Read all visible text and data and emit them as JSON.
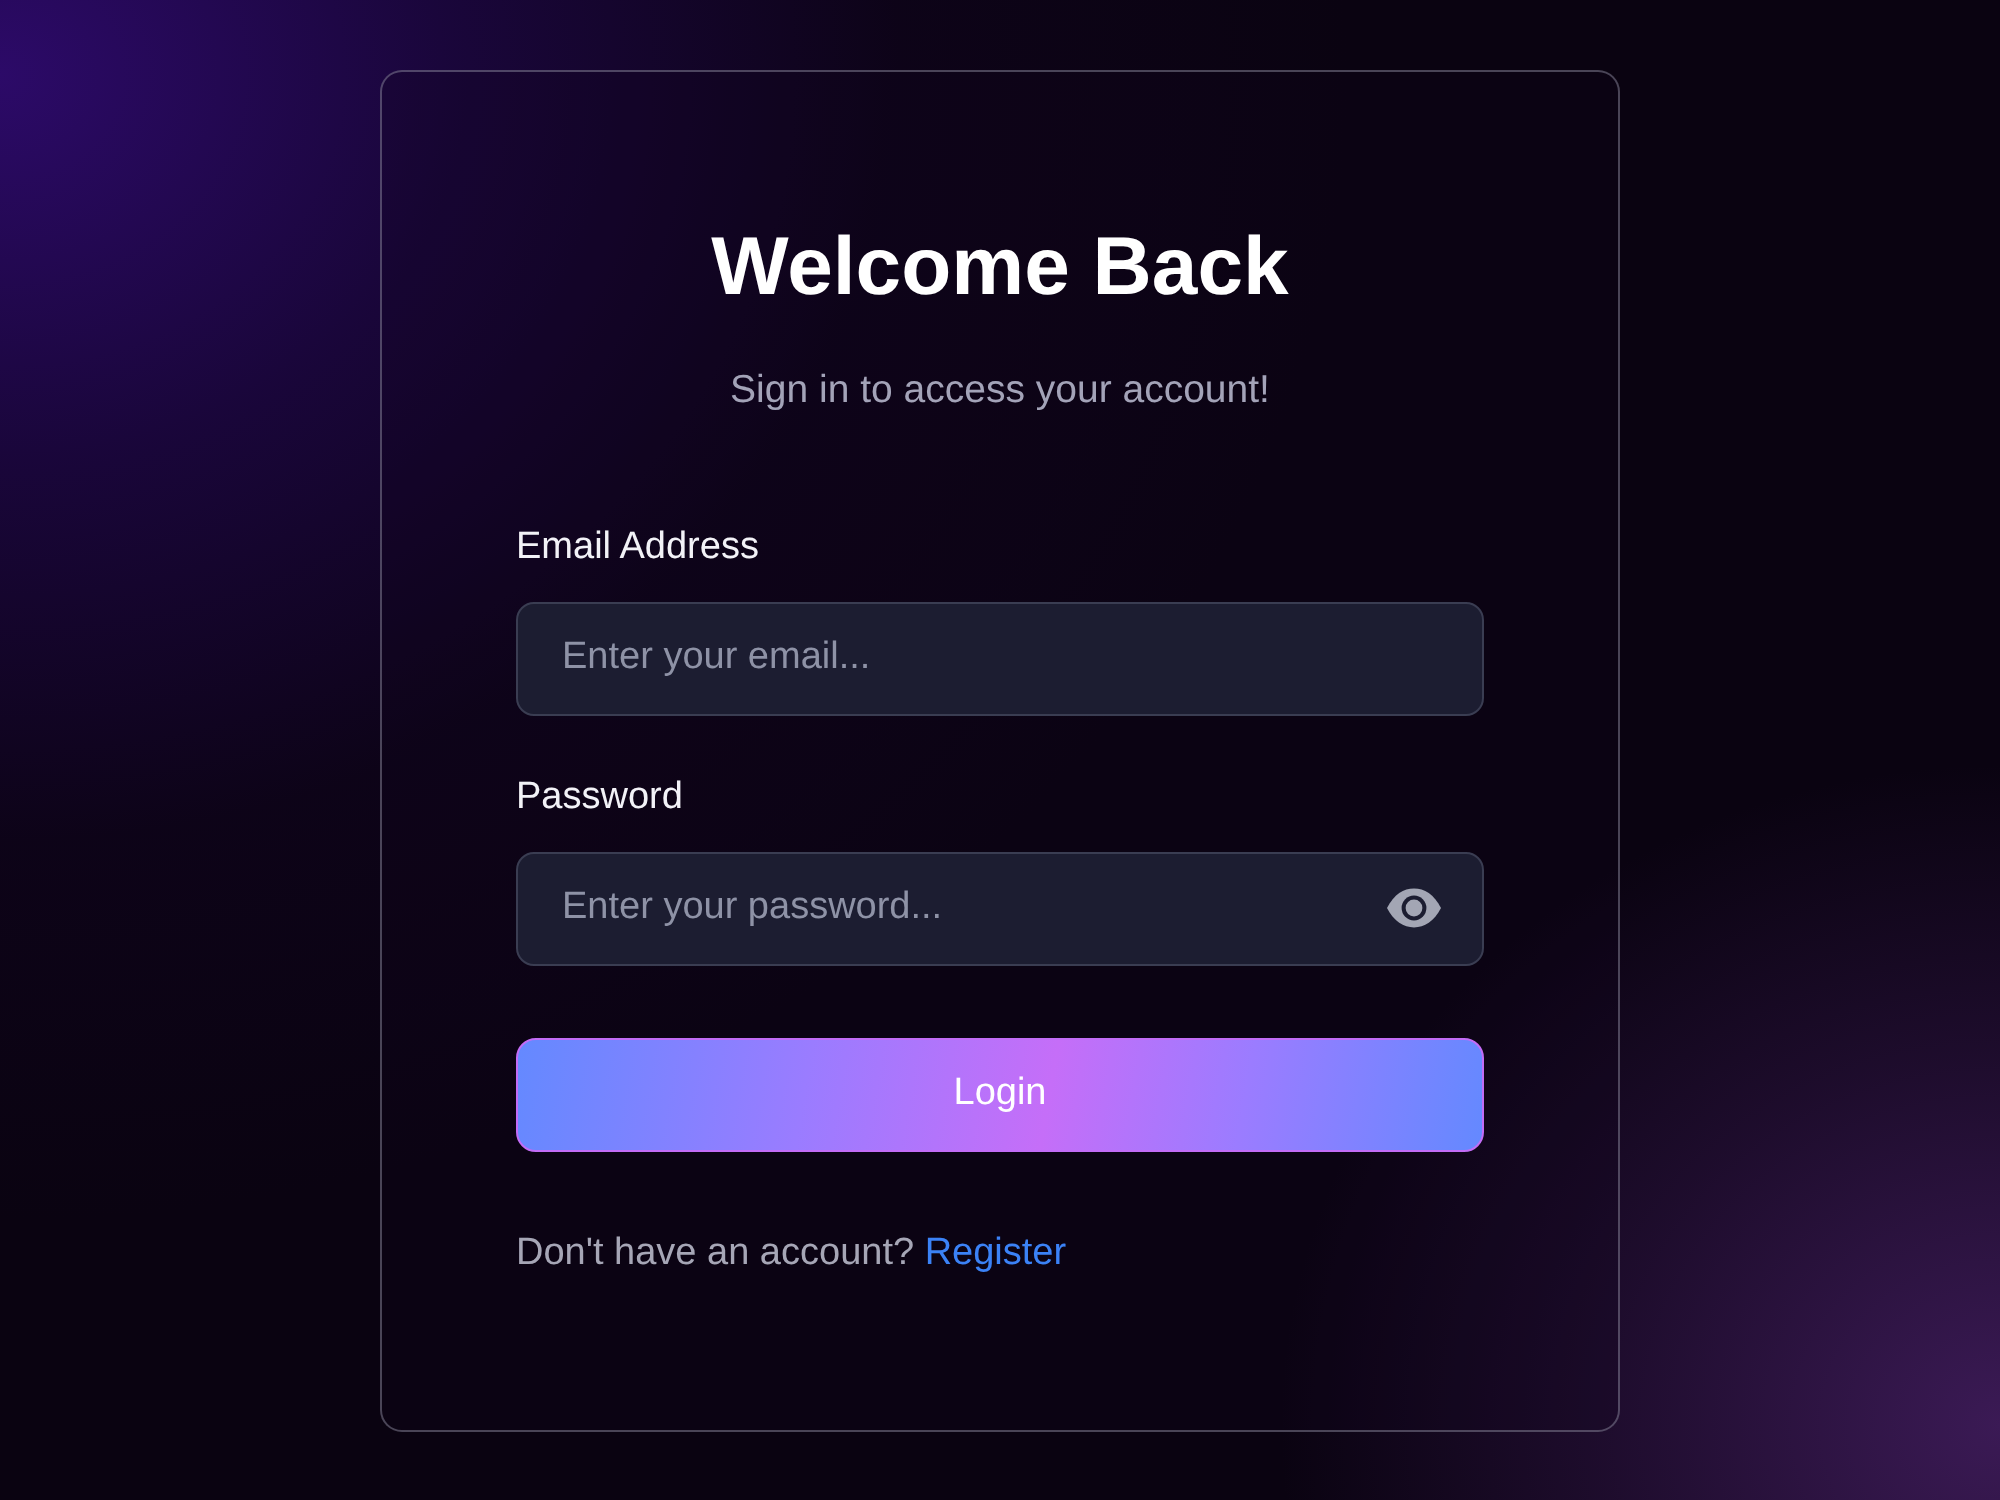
{
  "card": {
    "title": "Welcome Back",
    "subtitle": "Sign in to access your account!"
  },
  "fields": [
    {
      "kind": "email",
      "label": "Email Address",
      "placeholder": "Enter your email..."
    },
    {
      "kind": "password",
      "label": "Password",
      "placeholder": "Enter your password..."
    }
  ],
  "login_button": {
    "label": "Login"
  },
  "footer": {
    "prompt": "Don't have an account?",
    "link": "Register"
  }
}
